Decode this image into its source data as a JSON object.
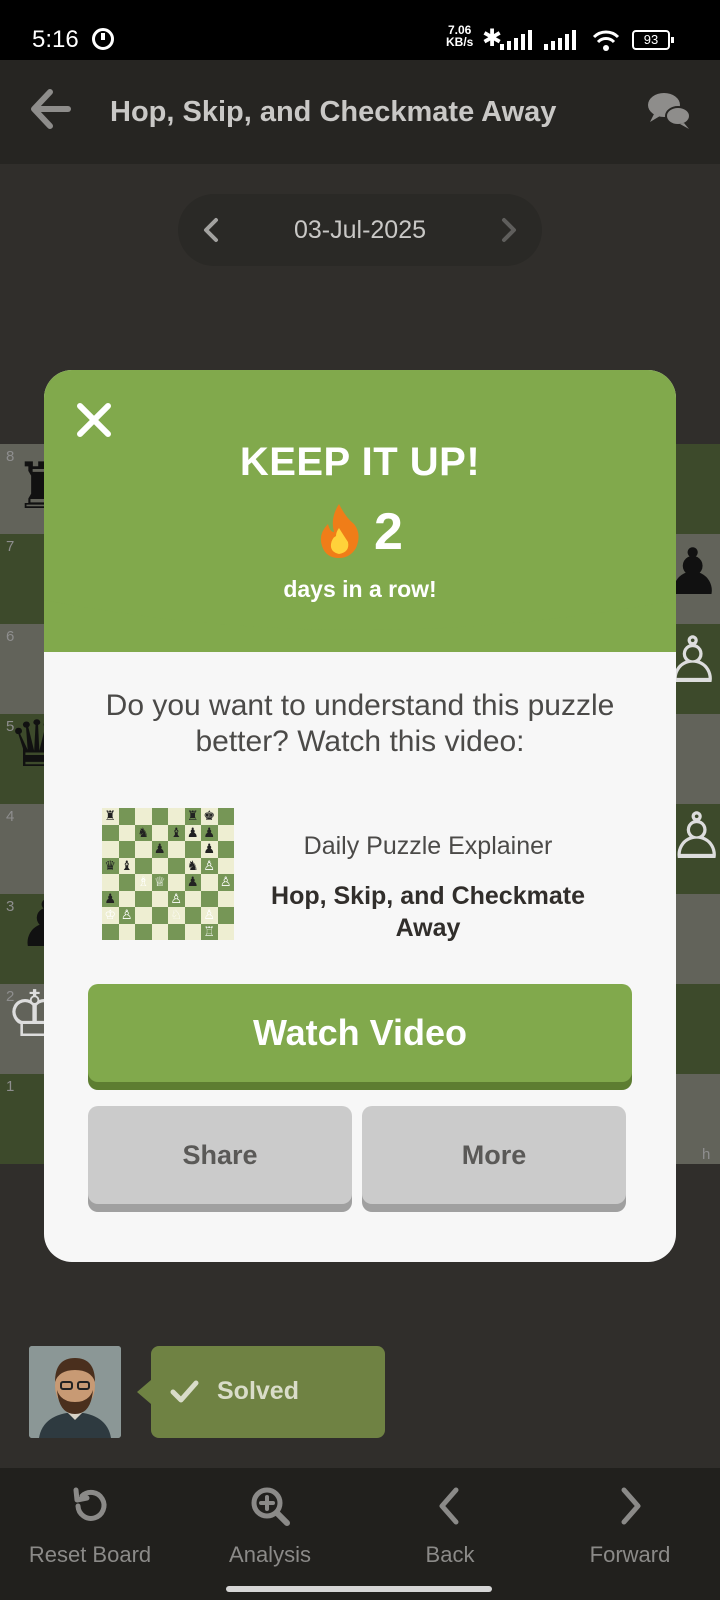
{
  "status_bar": {
    "time": "5:16",
    "net_speed_value": "7.06",
    "net_speed_unit": "KB/s",
    "battery": "93"
  },
  "header": {
    "title": "Hop, Skip, and Checkmate Away",
    "back_icon": "arrow-left-icon",
    "chat_icon": "chat-bubbles-icon"
  },
  "date_nav": {
    "date": "03-Jul-2025"
  },
  "board": {
    "rank_labels": [
      "8",
      "7",
      "6",
      "5",
      "4",
      "3",
      "2",
      "1"
    ],
    "file_label_h": "h"
  },
  "modal": {
    "title": "KEEP IT UP!",
    "streak_count": "2",
    "streak_label": "days in a row!",
    "prompt": "Do you want to understand this puzzle better? Watch this video:",
    "video": {
      "label": "Daily Puzzle Explainer",
      "title": "Hop, Skip, and Checkmate Away"
    },
    "buttons": {
      "watch": "Watch Video",
      "share": "Share",
      "more": "More"
    }
  },
  "solved_status": {
    "label": "Solved"
  },
  "bottom_nav": {
    "items": [
      {
        "label": "Reset Board",
        "icon": "reset-icon"
      },
      {
        "label": "Analysis",
        "icon": "magnifier-plus-icon"
      },
      {
        "label": "Back",
        "icon": "chevron-left-icon"
      },
      {
        "label": "Forward",
        "icon": "chevron-right-icon"
      }
    ]
  },
  "colors": {
    "accent_green": "#81a94c",
    "dark_background": "#302e2b",
    "modal_background": "#f7f7f7",
    "button_gray": "#cbcbcb"
  }
}
